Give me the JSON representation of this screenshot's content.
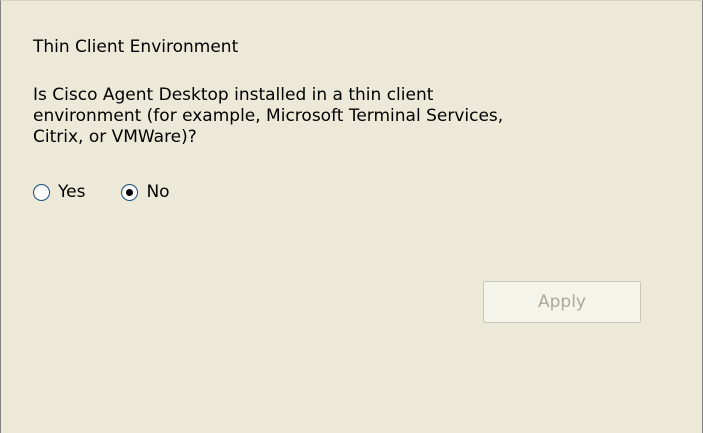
{
  "thin_client": {
    "title": "Thin Client Environment",
    "question_lines": [
      "Is Cisco Agent Desktop installed in a thin client",
      "environment (for example, Microsoft Terminal Services,",
      "Citrix, or VMWare)?"
    ],
    "options": [
      {
        "label": "Yes",
        "checked": false
      },
      {
        "label": "No",
        "checked": true
      }
    ],
    "apply_label": "Apply",
    "apply_enabled": false
  },
  "colors": {
    "panel_bg": "#ece9d8",
    "disabled_text": "#aca899",
    "radio_border": "#1c5180"
  }
}
